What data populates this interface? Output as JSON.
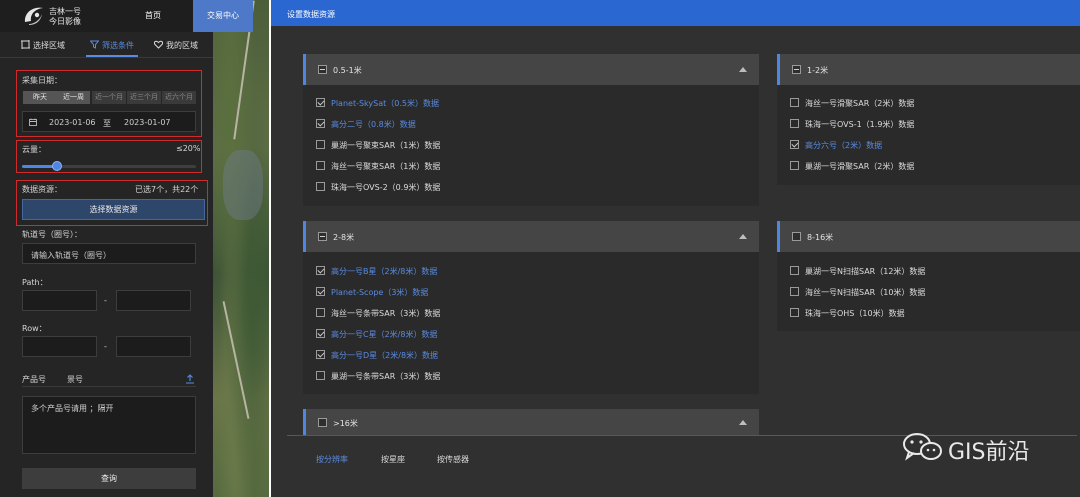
{
  "logo": {
    "line1": "吉林一号",
    "line2": "今日影像"
  },
  "nav": {
    "home": "首页",
    "trade": "交易中心"
  },
  "tabs": {
    "area": "选择区域",
    "filter": "筛选条件",
    "myarea": "我的区域"
  },
  "filters": {
    "collect_date_label": "采集日期：",
    "date_buttons": [
      "昨天",
      "近一周",
      "近一个月",
      "近三个月",
      "近六个月"
    ],
    "date_start": "2023-01-06",
    "date_sep": "至",
    "date_end": "2023-01-07",
    "cloud_label": "云量：",
    "cloud_value": "≤20%",
    "cloud_fraction": 0.2,
    "source_label": "数据资源：",
    "source_summary": "已选7个，共22个",
    "select_button": "选择数据资源",
    "orbit_label": "轨道号（圈号）：",
    "orbit_placeholder": "请输入轨道号（圈号）",
    "path_label": "Path：",
    "path_sep": "-",
    "row_label": "Row：",
    "row_sep": "-",
    "product_tab": "产品号",
    "scene_tab": "景号",
    "product_placeholder": "多个产品号请用 ；隔开",
    "query_button": "查询"
  },
  "dialog": {
    "title": "设置数据资源",
    "groups": [
      {
        "title": "0.5-1米",
        "state": "partial",
        "items": [
          {
            "label": "Planet-SkySat（0.5米）数据",
            "checked": true
          },
          {
            "label": "高分二号（0.8米）数据",
            "checked": true
          },
          {
            "label": "巢湖一号聚束SAR（1米）数据",
            "checked": false
          },
          {
            "label": "海丝一号聚束SAR（1米）数据",
            "checked": false
          },
          {
            "label": "珠海一号OVS-2（0.9米）数据",
            "checked": false
          }
        ]
      },
      {
        "title": "1-2米",
        "state": "partial",
        "items": [
          {
            "label": "海丝一号滑聚SAR（2米）数据",
            "checked": false
          },
          {
            "label": "珠海一号OVS-1（1.9米）数据",
            "checked": false
          },
          {
            "label": "高分六号（2米）数据",
            "checked": true
          },
          {
            "label": "巢湖一号滑聚SAR（2米）数据",
            "checked": false
          }
        ]
      },
      {
        "title": "2-8米",
        "state": "partial",
        "items": [
          {
            "label": "高分一号B星（2米/8米）数据",
            "checked": true
          },
          {
            "label": "Planet-Scope（3米）数据",
            "checked": true
          },
          {
            "label": "海丝一号条带SAR（3米）数据",
            "checked": false
          },
          {
            "label": "高分一号C星（2米/8米）数据",
            "checked": true
          },
          {
            "label": "高分一号D星（2米/8米）数据",
            "checked": true
          },
          {
            "label": "巢湖一号条带SAR（3米）数据",
            "checked": false
          }
        ]
      },
      {
        "title": "8-16米",
        "state": "none",
        "items": [
          {
            "label": "巢湖一号N扫描SAR（12米）数据",
            "checked": false
          },
          {
            "label": "海丝一号N扫描SAR（10米）数据",
            "checked": false
          },
          {
            "label": "珠海一号OHS（10米）数据",
            "checked": false
          }
        ]
      },
      {
        "title": ">16米",
        "state": "none",
        "items": []
      }
    ],
    "bottom_tabs": [
      "按分辨率",
      "按星座",
      "按传感器"
    ]
  },
  "watermark": {
    "text": "GIS前沿"
  },
  "colors": {
    "accent": "#4e86e4",
    "header": "#2a67d1",
    "highlight": "#d12a2a",
    "selected_text": "#5a8be0"
  }
}
